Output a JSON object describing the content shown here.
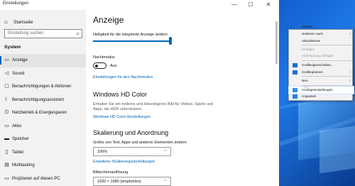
{
  "window": {
    "title": "Einstellungen",
    "minimize": "—",
    "maximize": "☐",
    "close": "✕"
  },
  "sidebar": {
    "home": "Startseite",
    "search_placeholder": "Einstellung suchen",
    "section": "System",
    "items": [
      {
        "label": "Anzeige",
        "icon": "display-icon",
        "glyph": "▭"
      },
      {
        "label": "Sound",
        "icon": "sound-icon",
        "glyph": "◁"
      },
      {
        "label": "Benachrichtigungen & Aktionen",
        "icon": "notifications-icon",
        "glyph": "▢"
      },
      {
        "label": "Benachrichtigungsassistent",
        "icon": "focus-assist-icon",
        "glyph": "☾"
      },
      {
        "label": "Netzbetrieb & Energiesparen",
        "icon": "power-icon",
        "glyph": "⏻"
      },
      {
        "label": "Akku",
        "icon": "battery-icon",
        "glyph": "▭"
      },
      {
        "label": "Speicher",
        "icon": "storage-icon",
        "glyph": "▬"
      },
      {
        "label": "Tablet",
        "icon": "tablet-icon",
        "glyph": "▯"
      },
      {
        "label": "Multitasking",
        "icon": "multitasking-icon",
        "glyph": "▤"
      },
      {
        "label": "Projizieren auf diesen PC",
        "icon": "project-icon",
        "glyph": "▭"
      }
    ]
  },
  "main": {
    "title": "Anzeige",
    "brightness_label": "Helligkeit für die integrierte Anzeige ändern",
    "brightness_value": 1.0,
    "nightmode_label": "Nachtmodus",
    "nightmode_state": "Aus",
    "nightmode_link": "Einstellungen für den Nachtmodus",
    "hd_title": "Windows HD Color",
    "hd_desc_1": "Erhalten Sie ein helleres und lebendigeres Bild für Videos, Spiele und",
    "hd_desc_2": "Apps, die HDR unterstützen.",
    "hd_link": "Windows HD Color-Einstellungen",
    "scale_title": "Skalierung und Anordnung",
    "scale_label": "Größe von Text, Apps und anderen Elementen ändern",
    "scale_value": "100%",
    "scale_link": "Erweiterte Skalierungseinstellungen",
    "resolution_label": "Bildschirmauflösung",
    "resolution_value": "1920 × 1080 (empfohlen)"
  },
  "context_menu": {
    "items": [
      {
        "label": "Ansicht",
        "submenu": true,
        "disabled": false
      },
      {
        "label": "Sortieren nach",
        "submenu": true,
        "disabled": false
      },
      {
        "label": "Aktualisieren",
        "submenu": false,
        "disabled": false
      },
      {
        "label": "Einfügen",
        "submenu": false,
        "disabled": true
      },
      {
        "label": "Verknüpfung einfügen",
        "submenu": false,
        "disabled": true
      },
      {
        "label": "Grafikeigenschaften...",
        "submenu": false,
        "disabled": false,
        "icon": "graphics-icon"
      },
      {
        "label": "Grafikoptionen",
        "submenu": true,
        "disabled": false,
        "icon": "graphics-icon"
      },
      {
        "label": "Neu",
        "submenu": true,
        "disabled": false
      },
      {
        "label": "Anzeigeeinstellungen",
        "submenu": false,
        "disabled": false,
        "icon": "display-settings-icon",
        "highlighted": true
      },
      {
        "label": "Anpassen",
        "submenu": false,
        "disabled": false,
        "icon": "personalize-icon"
      }
    ]
  },
  "colors": {
    "accent": "#0063b1",
    "window_bg": "#f2f2f2",
    "content_bg": "#ffffff",
    "desktop": "#0d55c4"
  }
}
